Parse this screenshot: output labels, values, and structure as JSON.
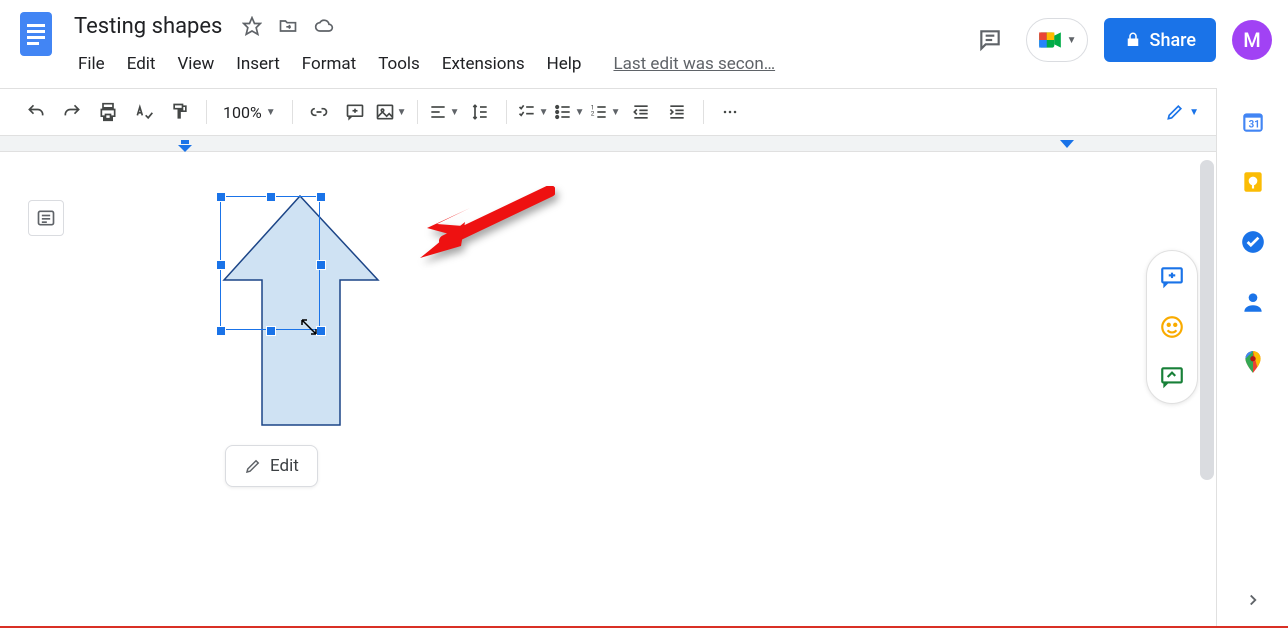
{
  "header": {
    "doc_title": "Testing shapes",
    "menu": [
      "File",
      "Edit",
      "View",
      "Insert",
      "Format",
      "Tools",
      "Extensions",
      "Help"
    ],
    "last_edit": "Last edit was secon…",
    "share_label": "Share",
    "avatar_initial": "M"
  },
  "toolbar": {
    "zoom": "100%"
  },
  "shape": {
    "edit_label": "Edit"
  },
  "icons": {
    "star": "☆",
    "move": "⇨",
    "cloud": "☁",
    "comments": "▤",
    "lock": "🔒"
  }
}
